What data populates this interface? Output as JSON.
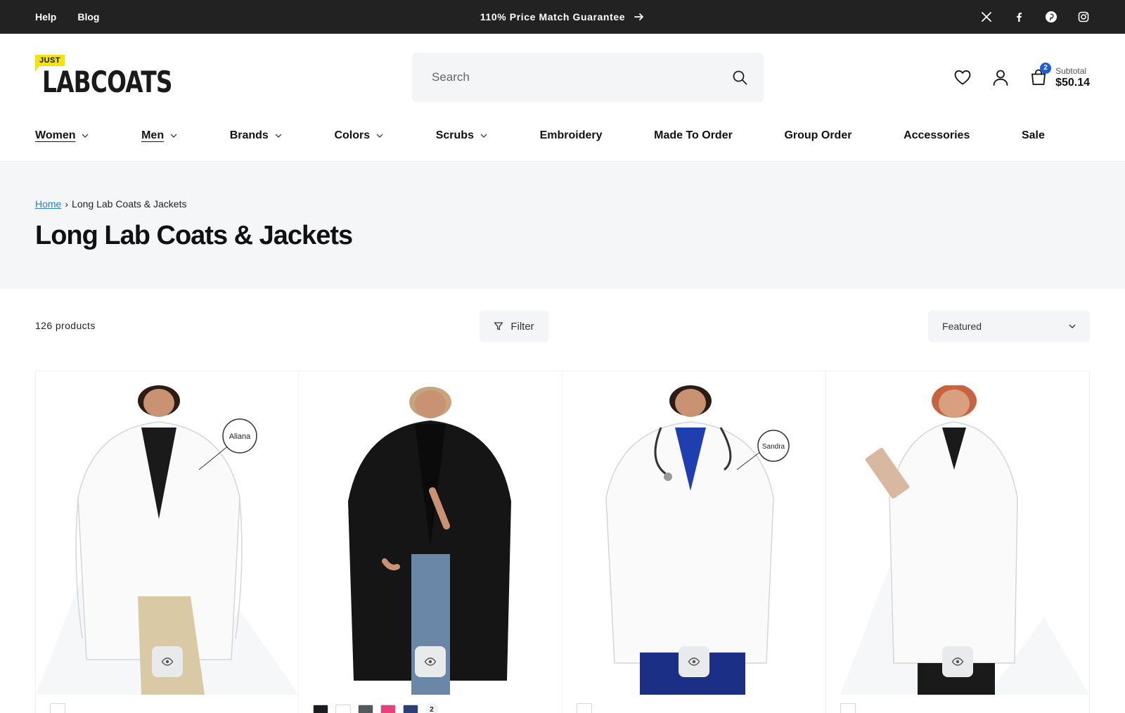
{
  "topbar": {
    "links": [
      "Help",
      "Blog"
    ],
    "promo": "110% Price Match Guarantee",
    "social_icons": [
      "x-icon",
      "facebook-icon",
      "pinterest-icon",
      "instagram-icon"
    ]
  },
  "logo": {
    "tag": "JUST",
    "word": "LABCOATS"
  },
  "search": {
    "placeholder": "Search"
  },
  "cart": {
    "count": "2",
    "subtotal_label": "Subtotal",
    "subtotal": "$50.14"
  },
  "nav": {
    "items": [
      {
        "label": "Women",
        "dropdown": true,
        "active": true
      },
      {
        "label": "Men",
        "dropdown": true,
        "active": true
      },
      {
        "label": "Brands",
        "dropdown": true
      },
      {
        "label": "Colors",
        "dropdown": true
      },
      {
        "label": "Scrubs",
        "dropdown": true
      },
      {
        "label": "Embroidery",
        "dropdown": false
      },
      {
        "label": "Made To Order",
        "dropdown": false
      },
      {
        "label": "Group Order",
        "dropdown": false
      },
      {
        "label": "Accessories",
        "dropdown": false
      },
      {
        "label": "Sale",
        "dropdown": false
      }
    ]
  },
  "breadcrumb": {
    "home": "Home",
    "separator": "›",
    "current": "Long Lab Coats & Jackets"
  },
  "page_title": "Long Lab Coats & Jackets",
  "toolbar": {
    "count": "126 products",
    "filter_label": "Filter",
    "sort_value": "Featured"
  },
  "products": [
    {
      "coat": "white",
      "badge_text": "Aliana",
      "swatches": []
    },
    {
      "coat": "black",
      "badge_text": "",
      "swatches": [
        "#1b1c20",
        "#ffffff",
        "#54575c",
        "#e8407c",
        "#2c3e73"
      ],
      "more": "2"
    },
    {
      "coat": "white",
      "badge_text": "Sandra",
      "swatches": []
    },
    {
      "coat": "white",
      "badge_text": "",
      "swatches": []
    }
  ],
  "colors": {
    "topbar": "#222222",
    "accent": "#1e5bd8",
    "logo_yellow": "#f7e300",
    "link": "#2a7fcf"
  }
}
